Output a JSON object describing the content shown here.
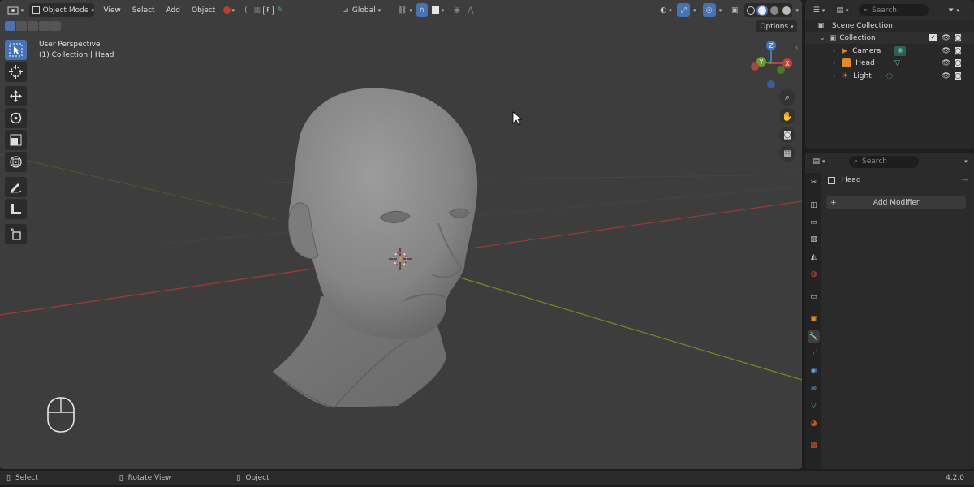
{
  "header": {
    "mode": "Object Mode",
    "menus": [
      "View",
      "Select",
      "Add",
      "Object"
    ],
    "orientation": "Global",
    "options": "Options"
  },
  "overlay": {
    "perspective": "User Perspective",
    "collection_path": "(1) Collection | Head"
  },
  "gizmo": {
    "x": "X",
    "y": "Y",
    "z": "Z"
  },
  "outliner": {
    "search_placeholder": "Search",
    "scene_collection": "Scene Collection",
    "collection": "Collection",
    "items": [
      {
        "label": "Camera",
        "icon": "camera-icon"
      },
      {
        "label": "Head",
        "icon": "mesh-icon"
      },
      {
        "label": "Light",
        "icon": "light-icon"
      }
    ]
  },
  "properties": {
    "search_placeholder": "Search",
    "object_name": "Head",
    "add_modifier": "Add Modifier"
  },
  "statusbar": {
    "select": "Select",
    "rotate": "Rotate View",
    "object": "Object",
    "version": "4.2.0"
  },
  "colors": {
    "accent": "#4772b3",
    "viewport_bg": "#3d3d3d",
    "x_axis": "#a33a3a",
    "y_axis": "#6b8f2a"
  }
}
